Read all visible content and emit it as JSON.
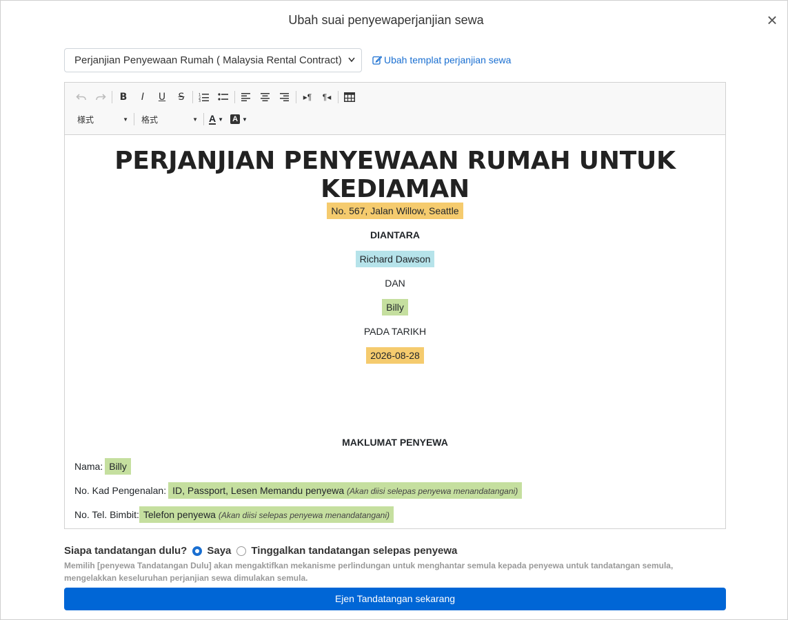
{
  "modal": {
    "title": "Ubah suai penyewaperjanjian sewa",
    "close": "×"
  },
  "template": {
    "selected": "Perjanjian Penyewaan Rumah ( Malaysia Rental Contract)",
    "edit_link": "Ubah templat perjanjian sewa"
  },
  "toolbar": {
    "styles_label": "様式",
    "formats_label": "格式",
    "icons": [
      "undo-icon",
      "redo-icon",
      "bold-icon",
      "italic-icon",
      "underline-icon",
      "strikethrough-icon",
      "numbered-list-icon",
      "bullet-list-icon",
      "align-left-icon",
      "align-center-icon",
      "align-right-icon",
      "ltr-icon",
      "rtl-icon",
      "table-icon",
      "text-color-icon",
      "background-color-icon"
    ]
  },
  "document": {
    "title": "PERJANJIAN PENYEWAAN RUMAH UNTUK KEDIAMAN",
    "address": "No. 567, Jalan Willow, Seattle",
    "between": "DIANTARA",
    "landlord": "Richard Dawson",
    "and": "DAN",
    "tenant": "Billy",
    "on_date_label": "PADA TARIKH",
    "date": "2026-08-28",
    "tenant_info_heading": "MAKLUMAT PENYEWA",
    "name_label": "Nama:",
    "name_value": "Billy",
    "id_label": "No. Kad Pengenalan:",
    "id_value": "ID, Passport, Lesen Memandu penyewa",
    "id_note": "(Akan diisi selepas penyewa menandatangani)",
    "phone_label": "No. Tel. Bimbit:",
    "phone_value": "Telefon penyewa",
    "phone_note": "(Akan diisi selepas penyewa menandatangani)"
  },
  "signing": {
    "question": "Siapa tandatangan dulu?",
    "option_me": "Saya",
    "option_tenant": "Tinggalkan tandatangan selepas penyewa",
    "selected": "Saya",
    "hint": "Memilih [penyewa Tandatangan Dulu] akan mengaktifkan mekanisme perlindungan untuk menghantar semula kepada penyewa untuk tandatangan semula, mengelakkan keseluruhan perjanjian sewa dimulakan semula.",
    "submit": "Ejen Tandatangan sekarang"
  },
  "colors": {
    "primary": "#0066d6",
    "link": "#1a6fd1",
    "highlight_orange": "#f5cb6e",
    "highlight_cyan": "#b6e3ea",
    "highlight_green": "#c5df9f"
  }
}
